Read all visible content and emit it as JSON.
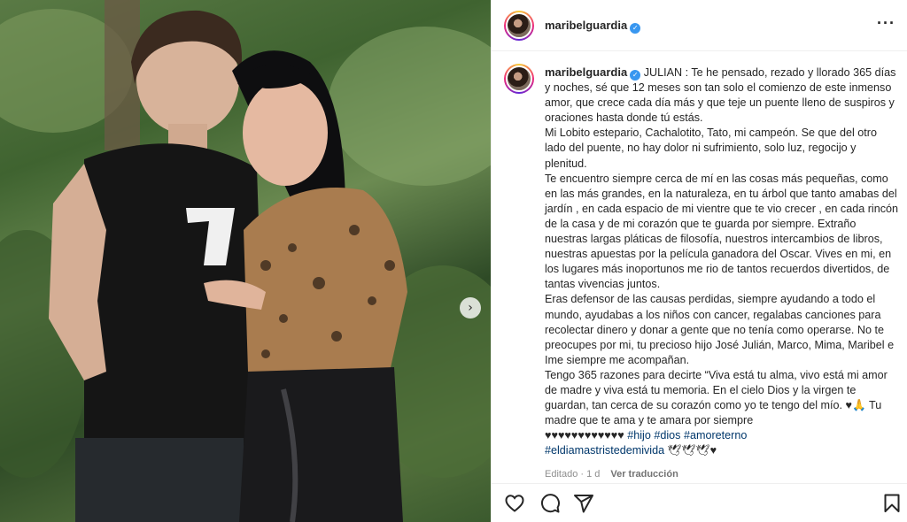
{
  "photo": {
    "image": "photo of a young man in a black t-shirt and a woman with long black hair in a leopard print blouse, posing in a garden",
    "next_icon": "chevron-right-icon"
  },
  "post": {
    "username": "maribelguardia",
    "more_icon": "more-horizontal-icon"
  },
  "caption": {
    "username": "maribelguardia",
    "paragraphs": [
      "JULIAN : Te he pensado, rezado y llorado 365 días y noches, sé que 12 meses son tan solo el comienzo de este inmenso amor, que crece cada día más y que teje un puente lleno de suspiros y oraciones hasta donde tú estás.",
      "Mi Lobito estepario, Cachalotito, Tato, mi campeón. Se que del otro lado del puente, no hay dolor ni sufrimiento, solo luz, regocijo y plenitud.",
      "Te encuentro siempre cerca de mí en las cosas más pequeñas, como en las más grandes, en la naturaleza, en tu árbol que tanto amabas del jardín , en cada espacio de mi vientre que te vio crecer , en cada rincón de la casa y de mi corazón que te guarda por siempre. Extraño nuestras largas pláticas de filosofía, nuestros intercambios de libros, nuestras apuestas por la película ganadora del Oscar. Vives en mi, en los lugares más inoportunos me rio de tantos recuerdos divertidos, de tantas vivencias juntos.",
      "Eras defensor de las causas perdidas, siempre ayudando a todo el mundo, ayudabas a los niños con cancer, regalabas canciones para recolectar dinero y donar a gente que no tenía como operarse. No te preocupes por mi, tu precioso hijo José Julián, Marco, Mima, Maribel e Ime siempre me acompañan.",
      "Tengo 365 razones para decirte “Viva está tu alma, vivo está mi amor de madre y viva está tu memoria. En el cielo Dios y la virgen te guardan, tan cerca de su corazón como yo te tengo del mío. ♥🙏 Tu madre que te ama y te amara por siempre"
    ],
    "hearts": "♥♥♥♥♥♥♥♥♥♥♥♥",
    "hashtags": [
      "#hijo",
      "#dios",
      "#amoreterno",
      "#eldiamastristedemivida"
    ],
    "trailing": "🕊🕊🕊♥",
    "edited": "Editado · 1 d",
    "translate_label": "Ver traducción"
  },
  "actions": {
    "like_icon": "heart-icon",
    "comment_icon": "comment-icon",
    "share_icon": "share-icon",
    "save_icon": "bookmark-icon"
  },
  "colors": {
    "verified": "#3897f0",
    "hashtag": "#00376b",
    "muted": "#8e8e8e"
  }
}
